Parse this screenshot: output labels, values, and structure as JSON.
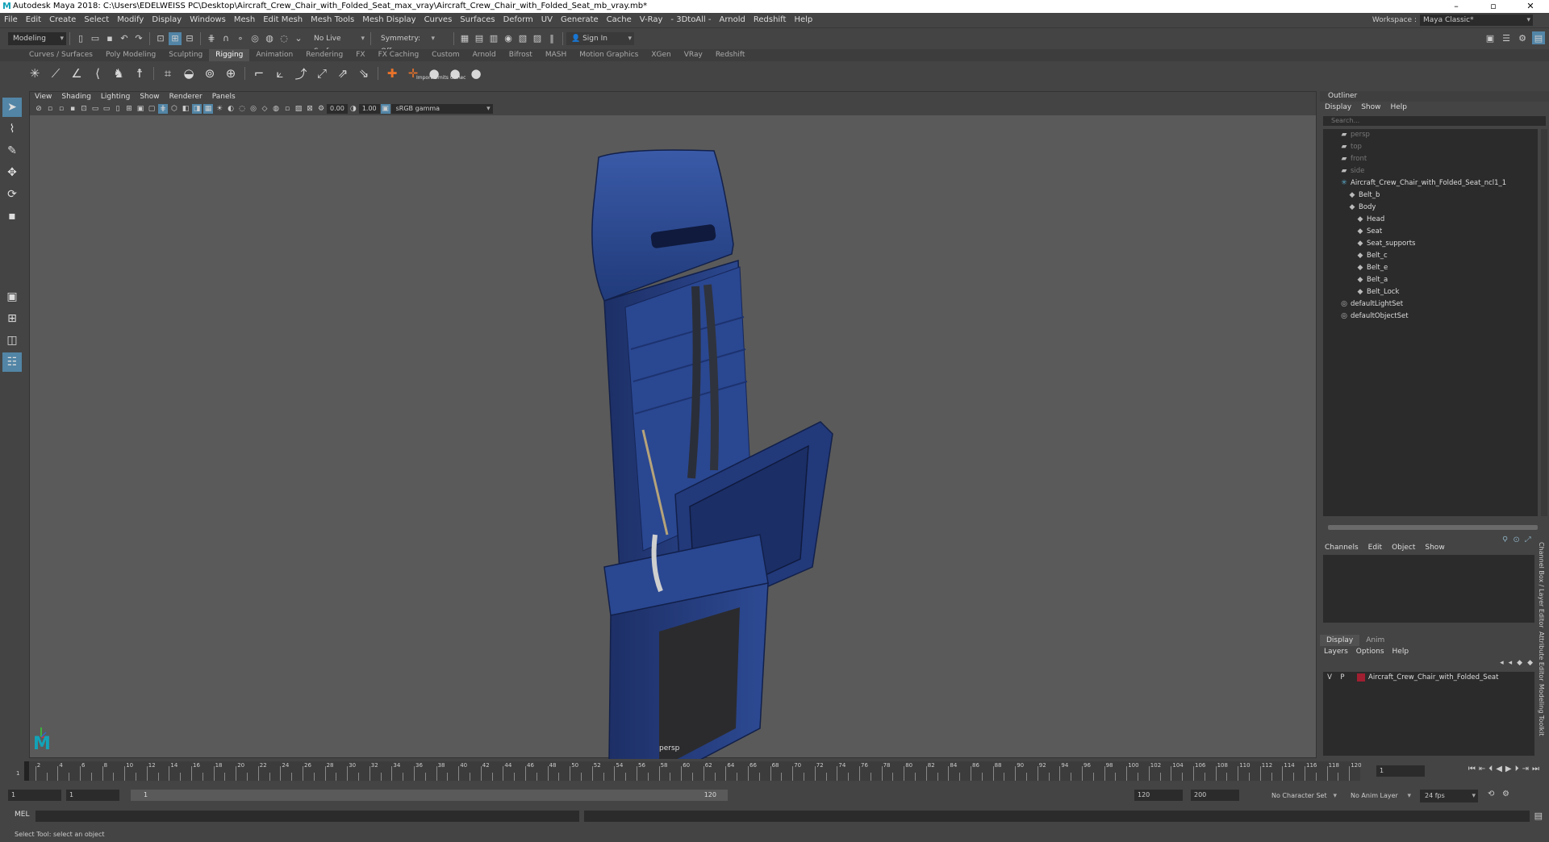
{
  "window": {
    "title": "Autodesk Maya 2018: C:\\Users\\EDELWEISS PC\\Desktop\\Aircraft_Crew_Chair_with_Folded_Seat_max_vray\\Aircraft_Crew_Chair_with_Folded_Seat_mb_vray.mb*",
    "controls": [
      "–",
      "▫",
      "✕"
    ]
  },
  "menubar": {
    "items": [
      "File",
      "Edit",
      "Create",
      "Select",
      "Modify",
      "Display",
      "Windows",
      "Mesh",
      "Edit Mesh",
      "Mesh Tools",
      "Mesh Display",
      "Curves",
      "Surfaces",
      "Deform",
      "UV",
      "Generate",
      "Cache",
      "V-Ray",
      "- 3DtoAll -",
      "Arnold",
      "Redshift",
      "Help"
    ],
    "workspace_label": "Workspace :",
    "workspace_value": "Maya Classic*"
  },
  "statusline": {
    "mode": "Modeling",
    "live_surface": "No Live Surface",
    "symmetry": "Symmetry: Off",
    "sign_in": "Sign In"
  },
  "shelf": {
    "tabs": [
      "Curves / Surfaces",
      "Poly Modeling",
      "Sculpting",
      "Rigging",
      "Animation",
      "Rendering",
      "FX",
      "FX Caching",
      "Custom",
      "Arnold",
      "Bifrost",
      "MASH",
      "Motion Graphics",
      "XGen",
      "VRay",
      "Redshift"
    ],
    "active_tab": "Rigging",
    "icon_caption": "Import Limits OffRec"
  },
  "viewport": {
    "menu": [
      "View",
      "Shading",
      "Lighting",
      "Show",
      "Renderer",
      "Panels"
    ],
    "exposure": "0.00",
    "gamma": "1.00",
    "colorspace": "sRGB gamma",
    "camera": "persp"
  },
  "outliner": {
    "title": "Outliner",
    "menu": [
      "Display",
      "Show",
      "Help"
    ],
    "search_placeholder": "Search...",
    "items": [
      {
        "label": "persp",
        "indent": 0,
        "icon": "camera-icon",
        "dim": true
      },
      {
        "label": "top",
        "indent": 0,
        "icon": "camera-icon",
        "dim": true
      },
      {
        "label": "front",
        "indent": 0,
        "icon": "camera-icon",
        "dim": true
      },
      {
        "label": "side",
        "indent": 0,
        "icon": "camera-icon",
        "dim": true
      },
      {
        "label": "Aircraft_Crew_Chair_with_Folded_Seat_ncl1_1",
        "indent": 0,
        "icon": "group-icon",
        "dim": false
      },
      {
        "label": "Belt_b",
        "indent": 1,
        "icon": "mesh-icon",
        "dim": false
      },
      {
        "label": "Body",
        "indent": 1,
        "icon": "mesh-icon",
        "dim": false
      },
      {
        "label": "Head",
        "indent": 2,
        "icon": "mesh-icon",
        "dim": false
      },
      {
        "label": "Seat",
        "indent": 2,
        "icon": "mesh-icon",
        "dim": false
      },
      {
        "label": "Seat_supports",
        "indent": 2,
        "icon": "mesh-icon",
        "dim": false
      },
      {
        "label": "Belt_c",
        "indent": 2,
        "icon": "mesh-icon",
        "dim": false
      },
      {
        "label": "Belt_e",
        "indent": 2,
        "icon": "mesh-icon",
        "dim": false
      },
      {
        "label": "Belt_a",
        "indent": 2,
        "icon": "mesh-icon",
        "dim": false
      },
      {
        "label": "Belt_Lock",
        "indent": 2,
        "icon": "mesh-icon",
        "dim": false
      },
      {
        "label": "defaultLightSet",
        "indent": 0,
        "icon": "set-icon",
        "dim": false
      },
      {
        "label": "defaultObjectSet",
        "indent": 0,
        "icon": "set-icon",
        "dim": false
      }
    ]
  },
  "channelbox": {
    "menu": [
      "Channels",
      "Edit",
      "Object",
      "Show"
    ]
  },
  "layereditor": {
    "tabs": [
      "Display",
      "Anim"
    ],
    "active_tab": "Display",
    "menu": [
      "Layers",
      "Options",
      "Help"
    ],
    "layer": {
      "v": "V",
      "p": "P",
      "name": "Aircraft_Crew_Chair_with_Folded_Seat",
      "color": "#a01f30"
    },
    "side_tabs": [
      "Channel Box / Layer Editor",
      "Attribute Editor",
      "Modeling Toolkit"
    ]
  },
  "timeslider": {
    "tick_labels": [
      "2",
      "4",
      "6",
      "8",
      "10",
      "12",
      "14",
      "16",
      "18",
      "20",
      "22",
      "24",
      "26",
      "28",
      "30",
      "32",
      "34",
      "36",
      "38",
      "40",
      "42",
      "44",
      "46",
      "48",
      "50",
      "52",
      "54",
      "56",
      "58",
      "60",
      "62",
      "64",
      "66",
      "68",
      "70",
      "72",
      "74",
      "76",
      "78",
      "80",
      "82",
      "84",
      "86",
      "88",
      "90",
      "92",
      "94",
      "96",
      "98",
      "100",
      "102",
      "104",
      "106",
      "108",
      "110",
      "112",
      "114",
      "116",
      "118",
      "120"
    ],
    "current_frame": "1",
    "first_tick": "1"
  },
  "rangeslider": {
    "start": "1",
    "inner_start": "1",
    "range_start_label": "1",
    "range_end_label": "120",
    "end": "120",
    "anim_end": "200",
    "character_set": "No Character Set",
    "anim_layer": "No Anim Layer",
    "fps": "24 fps"
  },
  "cmdline": {
    "label": "MEL"
  },
  "helpline": {
    "text": "Select Tool: select an object"
  }
}
